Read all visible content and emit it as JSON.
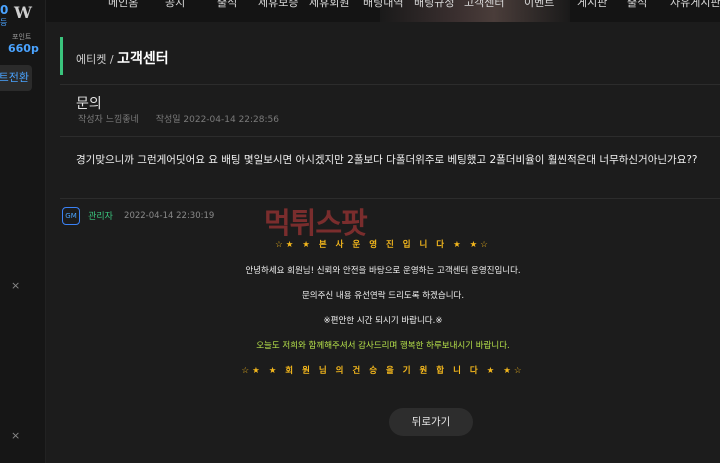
{
  "topnav": {
    "items": [
      "메인홈",
      "공지",
      "출석",
      "제휴보증",
      "제휴회원",
      "배팅내역",
      "배팅규정",
      "고객센터",
      "이벤트",
      "게시판",
      "출석",
      "자유게시판"
    ]
  },
  "sidebar": {
    "level_value": "0",
    "circle_label": "등",
    "logo_glyph": "W",
    "point_label": "포인트",
    "points": "660p",
    "convert_label": "트전환",
    "close_glyph": "×"
  },
  "breadcrumb": {
    "parent": "에티켓 /",
    "current": "고객센터"
  },
  "post": {
    "title": "문의",
    "author": "작성자 느낌좋네",
    "date": "작성일 2022-04-14 22:28:56",
    "question": "경기맞으니까 그런게어딧어요 요 배팅 몇일보시면 아시겠지만 2폴보다 다폴더위주로 베팅했고 2폴더비율이 훨씬적은대 너무하신거아닌가요??"
  },
  "answer": {
    "badge": "GM",
    "author": "관리자",
    "time": "2022-04-14 22:30:19",
    "lines": [
      "☆★ ★ 본 사 운 영 진 입 니 다 ★ ★☆",
      "안녕하세요 회원님! 신뢰와 안전을 바탕으로 운영하는 고객센터 운영진입니다.",
      "문의주신 내용 유선연락 드리도록 하겠습니다.",
      "※편안한 시간 되시기 바랍니다.※",
      "오늘도 저희와 함께해주셔서 감사드리며 행복한 하루보내시기 바랍니다.",
      "☆★ ★ 회 원 님 의 건 승 을 기 원 합 니 다 ★ ★☆"
    ]
  },
  "watermark": {
    "text": "먹튀스팟"
  },
  "buttons": {
    "back": "뒤로가기"
  },
  "colors": {
    "accent_blue": "#4aa3ff",
    "accent_green": "#3ac47d",
    "gold": "#f5b81c",
    "lime": "#b5e04a"
  }
}
